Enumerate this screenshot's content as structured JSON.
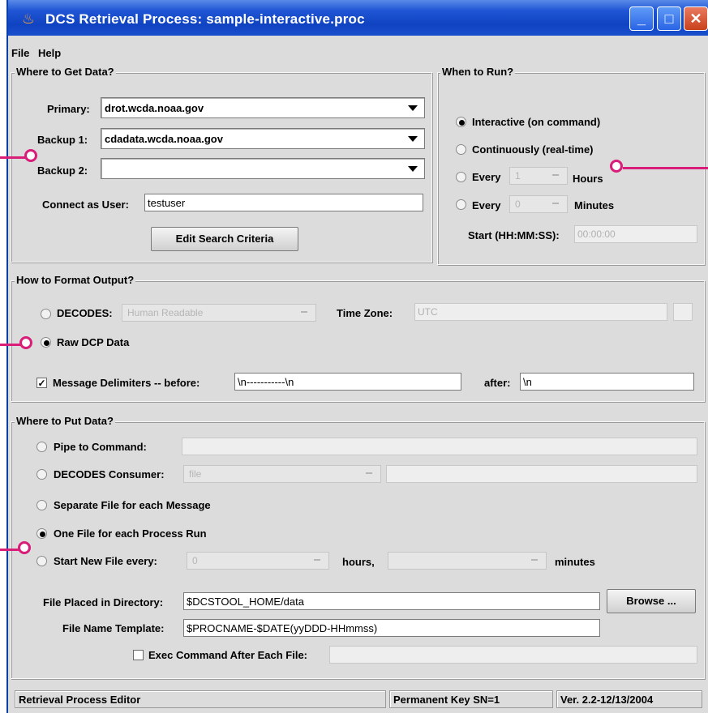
{
  "window": {
    "title": "DCS Retrieval Process: sample-interactive.proc",
    "minimize_icon": "minimize-icon",
    "maximize_icon": "maximize-icon",
    "close_icon": "close-icon",
    "accent": "#1f55d4"
  },
  "menu": {
    "file": "File",
    "help": "Help"
  },
  "where_to_get": {
    "legend": "Where to Get Data?",
    "primary_label": "Primary:",
    "primary_value": "drot.wcda.noaa.gov",
    "backup1_label": "Backup 1:",
    "backup1_value": "cdadata.wcda.noaa.gov",
    "backup2_label": "Backup 2:",
    "backup2_value": "",
    "user_label": "Connect as User:",
    "user_value": "testuser",
    "edit_button": "Edit Search Criteria"
  },
  "when_to_run": {
    "legend": "When to Run?",
    "interactive": "Interactive (on command)",
    "continuously": "Continuously (real-time)",
    "every1": "Every",
    "hours_value": "1",
    "hours": "Hours",
    "every2": "Every",
    "minutes_value": "0",
    "minutes": "Minutes",
    "start_label": "Start (HH:MM:SS):",
    "start_value": "00:00:00"
  },
  "format": {
    "legend": "How to Format Output?",
    "decodes": "DECODES:",
    "decodes_value": "Human Readable",
    "timezone_label": "Time Zone:",
    "timezone_value": "UTC",
    "raw": "Raw DCP Data",
    "delims_label": "Message Delimiters -- before:",
    "before_value": "\\n-----------\\n",
    "after_label": "after:",
    "after_value": "\\n"
  },
  "where_to_put": {
    "legend": "Where to Put Data?",
    "pipe": "Pipe to Command:",
    "consumer": "DECODES Consumer:",
    "consumer_value": "file",
    "separate": "Separate File for each Message",
    "one_file": "One File for each Process Run",
    "start_new": "Start New File every:",
    "new_hours_value": "0",
    "hours": "hours,",
    "minutes": "minutes",
    "dir_label": "File Placed in Directory:",
    "dir_value": "$DCSTOOL_HOME/data",
    "browse": "Browse ...",
    "template_label": "File Name Template:",
    "template_value": "$PROCNAME-$DATE(yyDDD-HHmmss)",
    "exec_label": "Exec Command After Each File:"
  },
  "status": {
    "editor": "Retrieval Process Editor",
    "key": "Permanent Key SN=1",
    "version": "Ver. 2.2-12/13/2004"
  }
}
